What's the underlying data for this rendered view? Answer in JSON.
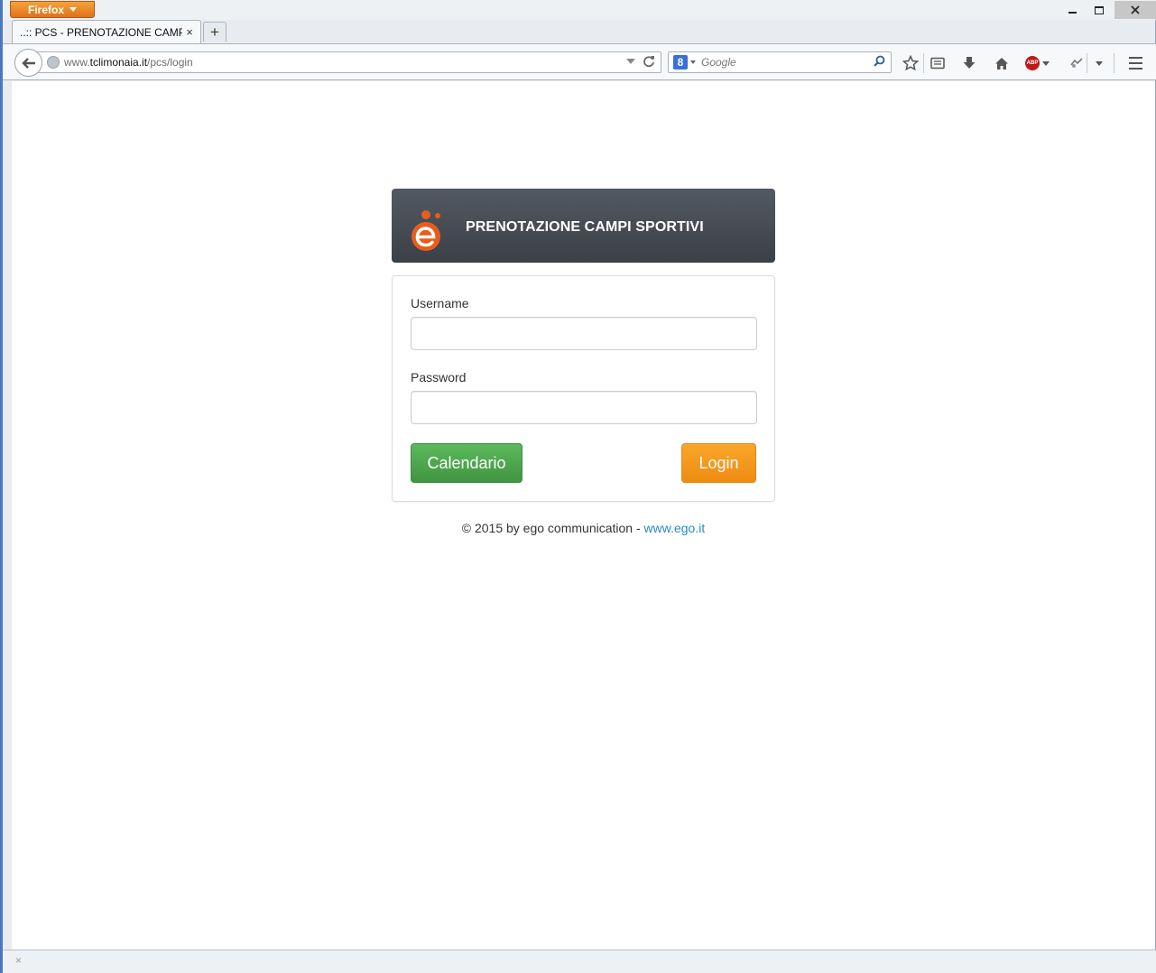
{
  "browser": {
    "menu_label": "Firefox",
    "tab_title": "..:: PCS - PRENOTAZIONE CAMPI...",
    "tab_close": "×",
    "new_tab": "+",
    "url_prefix": "www.",
    "url_domain": "tclimonaia.it",
    "url_path": "/pcs/login",
    "search_placeholder": "Google",
    "search_engine_icon": "8",
    "abp_label": "ABP",
    "addon_close": "×"
  },
  "header": {
    "title": "PRENOTAZIONE CAMPI SPORTIVI"
  },
  "form": {
    "username_label": "Username",
    "username_value": "",
    "password_label": "Password",
    "password_value": "",
    "calendar_button": "Calendario",
    "login_button": "Login"
  },
  "footer": {
    "text": "© 2015 by ego communication - ",
    "link_text": "www.ego.it"
  },
  "colors": {
    "brand_orange": "#e85d1a",
    "header_bg": "#474c54",
    "green_button": "#4cae4c",
    "orange_button": "#f39a1e",
    "link": "#2a88c8"
  }
}
